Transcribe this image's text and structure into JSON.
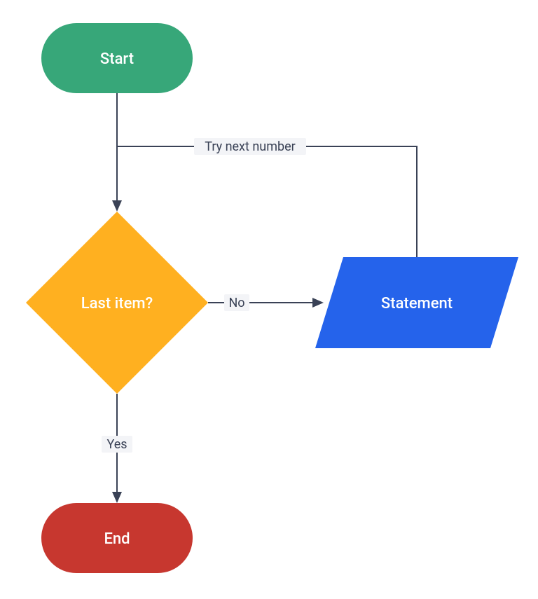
{
  "diagram": {
    "nodes": {
      "start": {
        "label": "Start",
        "type": "terminator",
        "fill": "#37A779"
      },
      "decision": {
        "label": "Last item?",
        "type": "decision",
        "fill": "#FFB020"
      },
      "statement": {
        "label": "Statement",
        "type": "io",
        "fill": "#2563EB"
      },
      "end": {
        "label": "End",
        "type": "terminator",
        "fill": "#C7372F"
      }
    },
    "edges": {
      "start_to_decision": {
        "label": ""
      },
      "decision_to_statement": {
        "label": "No"
      },
      "decision_to_end": {
        "label": "Yes"
      },
      "statement_to_decision": {
        "label": "Try next number"
      }
    }
  }
}
